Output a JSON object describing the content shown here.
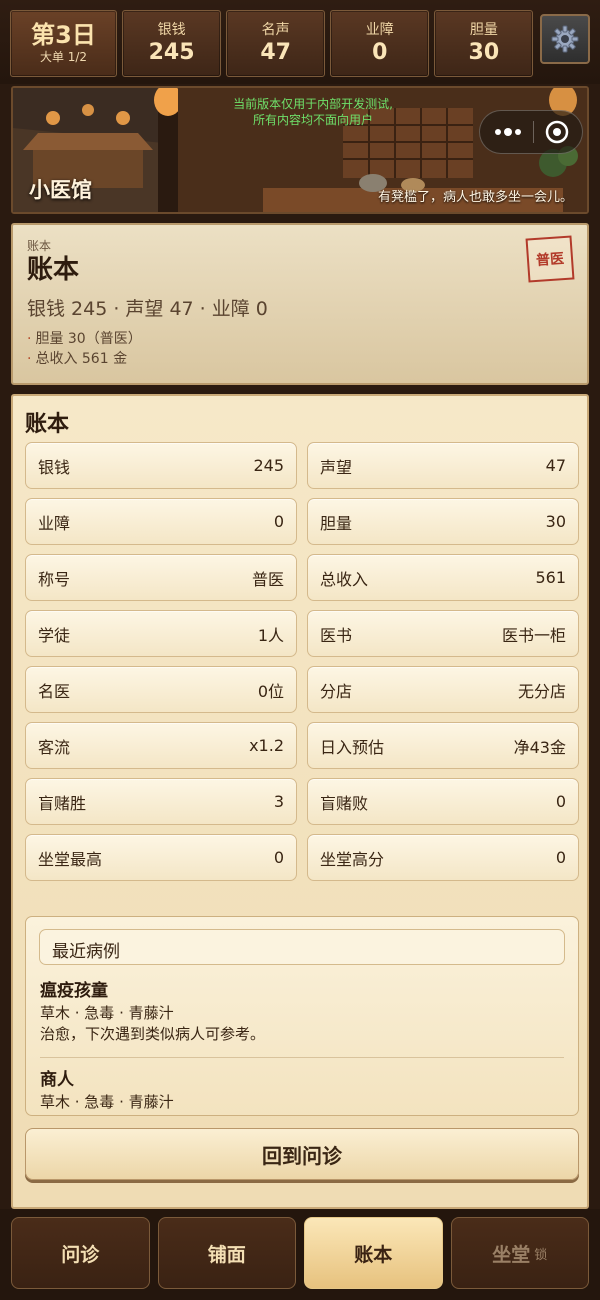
{
  "topbar": {
    "day": "第3日",
    "day_sub": "大单 1/2",
    "stats": [
      {
        "label": "银钱",
        "value": "245"
      },
      {
        "label": "名声",
        "value": "47"
      },
      {
        "label": "业障",
        "value": "0"
      },
      {
        "label": "胆量",
        "value": "30"
      }
    ],
    "settings_icon": "gear-icon"
  },
  "banner": {
    "shop_name": "小医馆",
    "notice_line1": "当前版本仅用于内部开发测试,",
    "notice_line2": "所有内容均不面向用户",
    "flavor": "有凳槛了，病人也敢多坐一会儿。",
    "capsule_icons": [
      "more-dots-icon",
      "close-circle-icon"
    ]
  },
  "header": {
    "kicker": "账本",
    "title": "账本",
    "summary": "银钱 245 · 声望 47 · 业障 0",
    "notes": [
      "胆量 30（普医）",
      "总收入 561 金"
    ],
    "stamp": "普医"
  },
  "ledger": {
    "title": "账本",
    "cells": [
      {
        "label": "银钱",
        "value": "245"
      },
      {
        "label": "声望",
        "value": "47"
      },
      {
        "label": "业障",
        "value": "0"
      },
      {
        "label": "胆量",
        "value": "30"
      },
      {
        "label": "称号",
        "value": "普医"
      },
      {
        "label": "总收入",
        "value": "561"
      },
      {
        "label": "学徒",
        "value": "1人"
      },
      {
        "label": "医书",
        "value": "医书一柜"
      },
      {
        "label": "名医",
        "value": "0位"
      },
      {
        "label": "分店",
        "value": "无分店"
      },
      {
        "label": "客流",
        "value": "x1.2"
      },
      {
        "label": "日入预估",
        "value": "净43金"
      },
      {
        "label": "盲赌胜",
        "value": "3"
      },
      {
        "label": "盲赌败",
        "value": "0"
      },
      {
        "label": "坐堂最高",
        "value": "0"
      },
      {
        "label": "坐堂高分",
        "value": "0"
      }
    ],
    "recent_title": "最近病例",
    "cases": [
      {
        "name": "瘟疫孩童",
        "herbs": "草木 · 急毒 · 青藤汁",
        "result": "治愈，下次遇到类似病人可参考。"
      },
      {
        "name": "商人",
        "herbs": "草木 · 急毒 · 青藤汁"
      }
    ],
    "back_button": "回到问诊"
  },
  "tabs": [
    {
      "label": "问诊"
    },
    {
      "label": "铺面"
    },
    {
      "label": "账本"
    },
    {
      "label": "坐堂",
      "badge": "锁"
    }
  ]
}
